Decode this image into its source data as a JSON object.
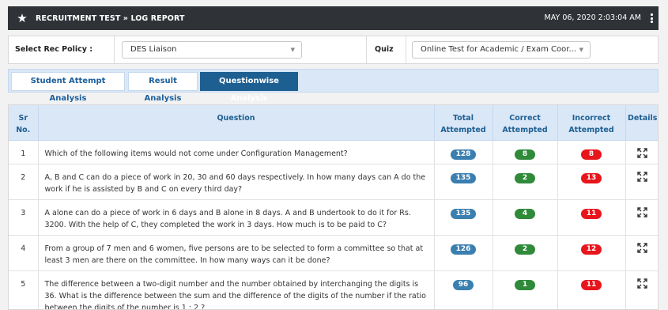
{
  "header": {
    "title": "RECRUITMENT TEST » LOG REPORT",
    "datetime": "MAY 06, 2020  2:03:04 AM"
  },
  "filters": {
    "rec_policy_label": "Select Rec Policy :",
    "rec_policy_value": "DES Liaison",
    "quiz_label": "Quiz",
    "quiz_value": "Online Test for Academic / Exam Coor..."
  },
  "tabs": [
    {
      "label": "Student Attempt Analysis",
      "active": false
    },
    {
      "label": "Result Analysis",
      "active": false
    },
    {
      "label": "Questionwise Analysis",
      "active": true
    }
  ],
  "table": {
    "columns": {
      "sr_line1": "Sr",
      "sr_line2": "No.",
      "question": "Question",
      "total_line1": "Total",
      "total_line2": "Attempted",
      "correct_line1": "Correct",
      "correct_line2": "Attempted",
      "incorrect_line1": "Incorrect",
      "incorrect_line2": "Attempted",
      "details": "Details"
    },
    "rows": [
      {
        "sr": "1",
        "question": "Which of the following items would not come under Configuration Management?",
        "total": "128",
        "correct": "8",
        "incorrect": "8"
      },
      {
        "sr": "2",
        "question": "A, B and C can do a piece of work in 20, 30 and 60 days respectively. In how many days can A do the work if he is assisted by B and C on every third day?",
        "total": "135",
        "correct": "2",
        "incorrect": "13"
      },
      {
        "sr": "3",
        "question": "A alone can do a piece of work in 6 days and B alone in 8 days. A and B undertook to do it for Rs. 3200. With the help of C, they completed the work in 3 days. How much is to be paid to C?",
        "total": "135",
        "correct": "4",
        "incorrect": "11"
      },
      {
        "sr": "4",
        "question": "From a group of 7 men and 6 women, five persons are to be selected to form a committee so that at least 3 men are there on the committee. In how many ways can it be done?",
        "total": "126",
        "correct": "2",
        "incorrect": "12"
      },
      {
        "sr": "5",
        "question": "The difference between a two-digit number and the number obtained by interchanging the digits is 36. What is the difference between the sum and the difference of the digits of the number if the ratio between the digits of the number is 1 : 2 ?",
        "total": "96",
        "correct": "1",
        "incorrect": "11"
      }
    ]
  },
  "icons": {
    "header": "star-icon",
    "menu": "kebab-menu-icon",
    "dropdown": "caret-down-icon",
    "details": "expand-icon"
  },
  "colors": {
    "header_bg": "#2f3337",
    "accent": "#1e5f92",
    "total_badge": "#3a7fb0",
    "correct_badge": "#2f8a3a",
    "incorrect_badge": "#e8151c"
  }
}
